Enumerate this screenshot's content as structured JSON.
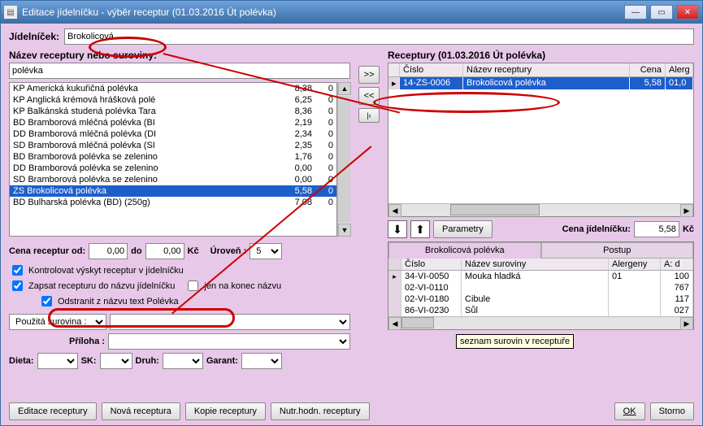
{
  "window": {
    "title": "Editace jídelníčku - výběr receptur (01.03.2016 Út polévka)"
  },
  "jidelnicek": {
    "label": "Jídelníček:",
    "value": "Brokolicová"
  },
  "search": {
    "label": "Název receptury nebo suroviny:",
    "value": "polévka"
  },
  "recipes": [
    {
      "name": "KP Americká kukuřičná polévka",
      "price": "8,38",
      "lvl": "0"
    },
    {
      "name": "KP Anglická krémová hrášková polé",
      "price": "6,25",
      "lvl": "0"
    },
    {
      "name": "KP Balkánská studená polévka Tara",
      "price": "8,36",
      "lvl": "0"
    },
    {
      "name": "BD Bramborová mléčná polévka (BI",
      "price": "2,19",
      "lvl": "0"
    },
    {
      "name": "DD Bramborová mléčná polévka (DI",
      "price": "2,34",
      "lvl": "0"
    },
    {
      "name": "SD Bramborová mléčná polévka (SI",
      "price": "2,35",
      "lvl": "0"
    },
    {
      "name": "BD Bramborová polévka se zelenino",
      "price": "1,76",
      "lvl": "0"
    },
    {
      "name": "DD Bramborová polévka se zelenino",
      "price": "0,00",
      "lvl": "0"
    },
    {
      "name": "SD Bramborová polévka se zelenino",
      "price": "0,00",
      "lvl": "0"
    },
    {
      "name": "ZS Brokolicová polévka",
      "price": "5,58",
      "lvl": "0",
      "sel": true
    },
    {
      "name": "BD Bulharská polévka (BD) (250g)",
      "price": "7,08",
      "lvl": "0"
    }
  ],
  "price_filter": {
    "label": "Cena receptur od:",
    "from": "0,00",
    "to_label": "do",
    "to": "0,00",
    "kc": "Kč",
    "lvl_label": "Úroveň :",
    "lvl": "5"
  },
  "checks": {
    "c1": "Kontrolovat výskyt receptur v jídelníčku",
    "c2": "Zapsat recepturu do názvu jídelníčku",
    "c2b": "jen na konec názvu",
    "c3": "Odstranit z názvu text Polévka"
  },
  "combos": {
    "surovina_label": "Použitá surovina :",
    "priloha_label": "Příloha :",
    "dieta": "Dieta:",
    "sk": "SK:",
    "druh": "Druh:",
    "garant": "Garant:"
  },
  "right": {
    "title": "Receptury (01.03.2016 Út polévka)",
    "cols": {
      "c1": "Číslo",
      "c2": "Název receptury",
      "c3": "Cena",
      "c4": "Alerg"
    },
    "row": {
      "num": "14-ZS-0006",
      "name": "Brokolicová polévka",
      "price": "5,58",
      "al": "01,0"
    },
    "params": "Parametry",
    "cena_label": "Cena jídelníčku:",
    "cena": "5,58",
    "kc": "Kč"
  },
  "ingredients": {
    "tab1": "Brokolicová polévka",
    "tab2": "Postup",
    "cols": {
      "c1": "Číslo",
      "c2": "Název suroviny",
      "c3": "Alergeny",
      "c4": "A: d"
    },
    "rows": [
      {
        "num": "34-VI-0050",
        "name": "Mouka hladká",
        "al": "01",
        "amt": "100"
      },
      {
        "num": "02-VI-0110",
        "name": "",
        "al": "",
        "amt": "767"
      },
      {
        "num": "02-VI-0180",
        "name": "Cibule",
        "al": "",
        "amt": "117"
      },
      {
        "num": "86-VI-0230",
        "name": "Sůl",
        "al": "",
        "amt": "027"
      }
    ],
    "tooltip": "seznam surovin v receptuře"
  },
  "footer": {
    "edit": "Editace receptury",
    "new": "Nová receptura",
    "copy": "Kopie receptury",
    "nutr": "Nutr.hodn. receptury",
    "ok": "OK",
    "cancel": "Storno"
  }
}
